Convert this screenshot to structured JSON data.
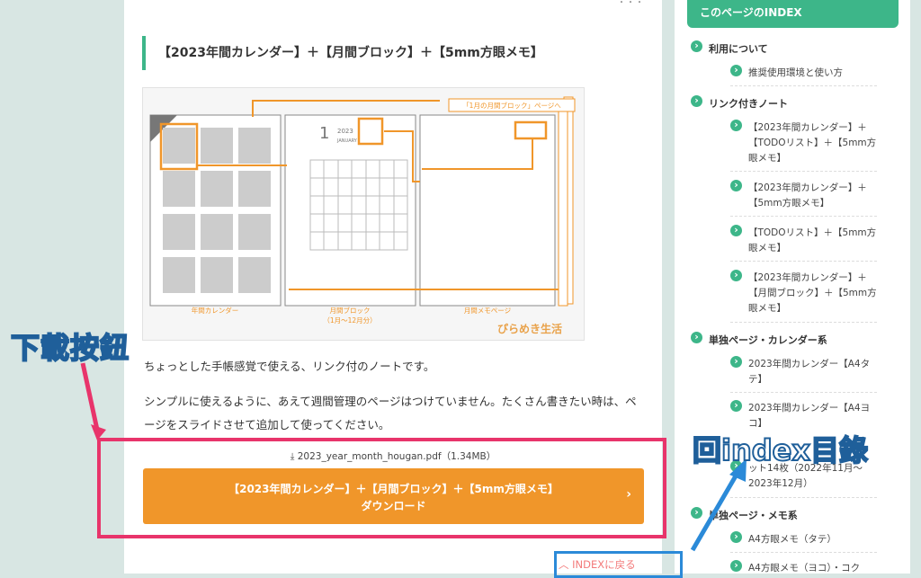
{
  "main": {
    "heading": "【2023年間カレンダー】＋【月間ブロック】＋【5mm方眼メモ】",
    "paragraph1": "ちょっとした手帳感覚で使える、リンク付のノートです。",
    "paragraph2_line1": "シンプルに使えるように、あえて週間管理のページはつけていません。たくさん書きたい時は、ペ",
    "paragraph2_line2": "ージをスライドさせて追加して使ってください。",
    "file_name": "2023_year_month_hougan.pdf（1.34MB）",
    "download_line1": "【2023年間カレンダー】＋【月間ブロック】＋【5mm方眼メモ】",
    "download_line2": "ダウンロード",
    "index_back": "INDEXに戻る"
  },
  "preview": {
    "panel_labels": [
      "年間カレンダー",
      "月間ブロック",
      "（1月〜12月分）",
      "月間メモページ"
    ],
    "callout": "「1月の月間ブロック」ページへ",
    "big_number": "1",
    "year": "2023",
    "month_en": "JANUARY",
    "brand": "ぴらめき生活"
  },
  "sidebar": {
    "title": "このページのINDEX",
    "sections": [
      {
        "label": "利用について",
        "items": [
          "推奨使用環境と使い方"
        ]
      },
      {
        "label": "リンク付きノート",
        "items": [
          "【2023年間カレンダー】＋【TODOリスト】＋【5mm方眼メモ】",
          "【2023年間カレンダー】＋【5mm方眼メモ】",
          "【TODOリスト】＋【5mm方眼メモ】",
          "【2023年間カレンダー】＋【月間ブロック】＋【5mm方眼メモ】"
        ]
      },
      {
        "label": "単独ページ・カレンダー系",
        "items": [
          "2023年間カレンダー【A4タテ】",
          "2023年間カレンダー【A4ヨコ】",
          "ット14枚（2022年11月〜2023年12月）"
        ]
      },
      {
        "label": "単独ページ・メモ系",
        "items": [
          "A4方眼メモ（タテ）",
          "A4方眼メモ（ヨコ）・コク"
        ]
      }
    ]
  },
  "annotations": {
    "download_label": "下載按鈕",
    "index_label": "回index目錄"
  },
  "colors": {
    "accent_green": "#3db689",
    "button_orange": "#f0962a",
    "annotation_pink": "#e8346b",
    "annotation_blue": "#2b8ad8"
  }
}
